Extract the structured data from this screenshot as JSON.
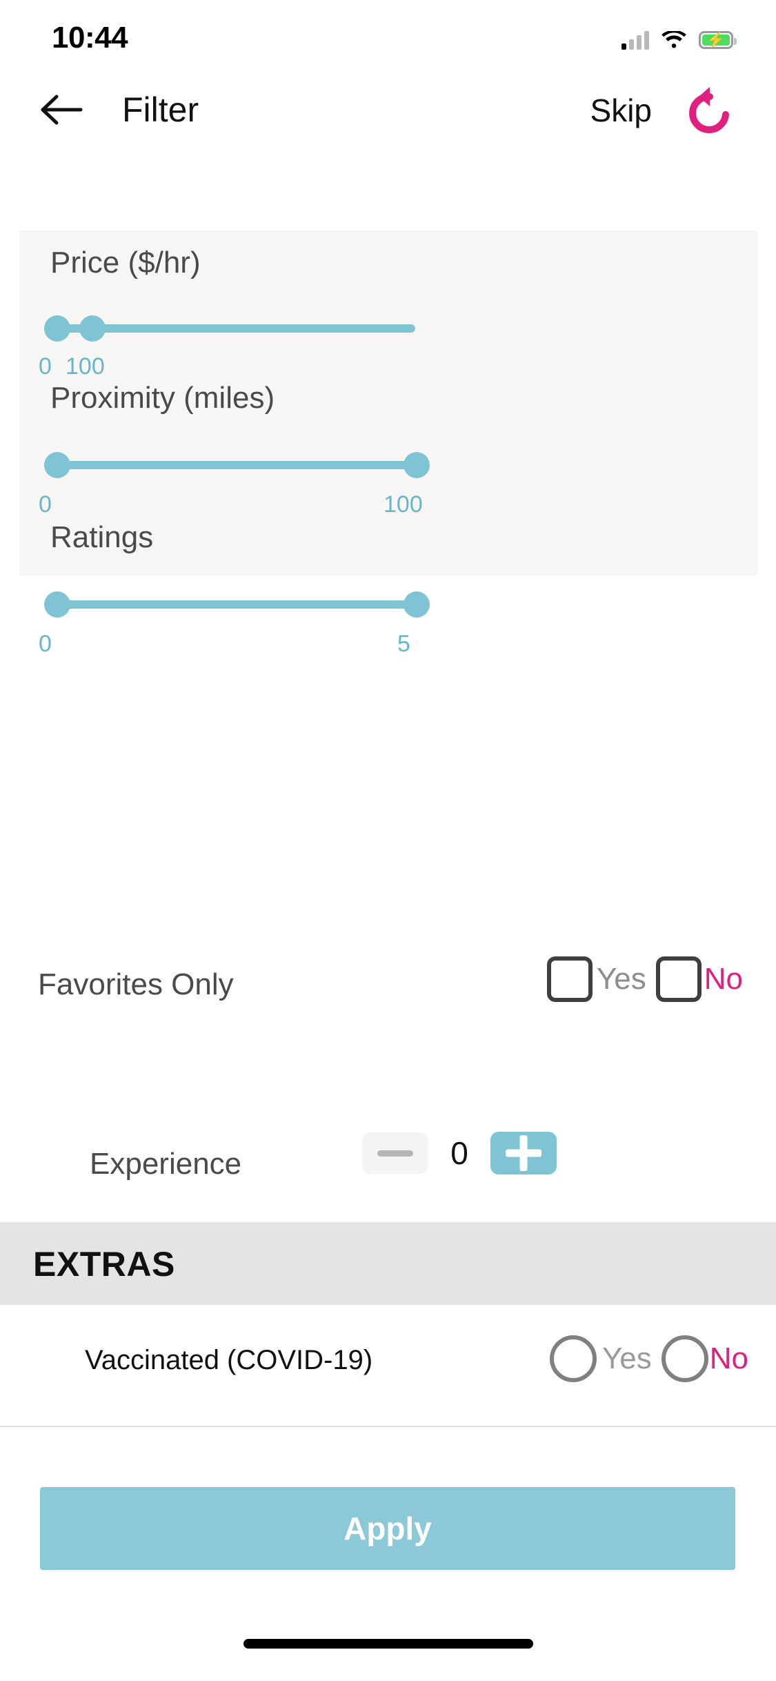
{
  "status_bar": {
    "time": "10:44",
    "signal_icon": "cellular-signal-icon",
    "wifi_icon": "wifi-icon",
    "battery_icon": "battery-charging-icon"
  },
  "nav": {
    "back_icon": "back-arrow-icon",
    "title": "Filter",
    "skip_label": "Skip",
    "reset_icon": "reset-refresh-icon",
    "reset_color": "#e01f7e"
  },
  "filters": {
    "accent_color": "#7ec4d4",
    "panel_background": "#f7f6f4",
    "sliders": [
      {
        "label": "Price ($/hr)",
        "min_value": "0",
        "max_value": "100"
      },
      {
        "label": "Proximity (miles)",
        "min_value": "0",
        "max_value": "100"
      },
      {
        "label": "Ratings",
        "min_value": "0",
        "max_value": "5"
      }
    ]
  },
  "favorites": {
    "label": "Favorites Only",
    "yes_label": "Yes",
    "no_label": "No",
    "yes_checked": false,
    "no_checked": false
  },
  "experience": {
    "label": "Experience",
    "value": "0",
    "minus_icon": "minus-icon",
    "plus_icon": "plus-icon"
  },
  "extras": {
    "title": "EXTRAS",
    "vaccinated": {
      "label": "Vaccinated (COVID-19)",
      "yes_label": "Yes",
      "no_label": "No",
      "yes_selected": false,
      "no_selected": false
    }
  },
  "apply": {
    "label": "Apply",
    "color": "#8bc8d8"
  }
}
